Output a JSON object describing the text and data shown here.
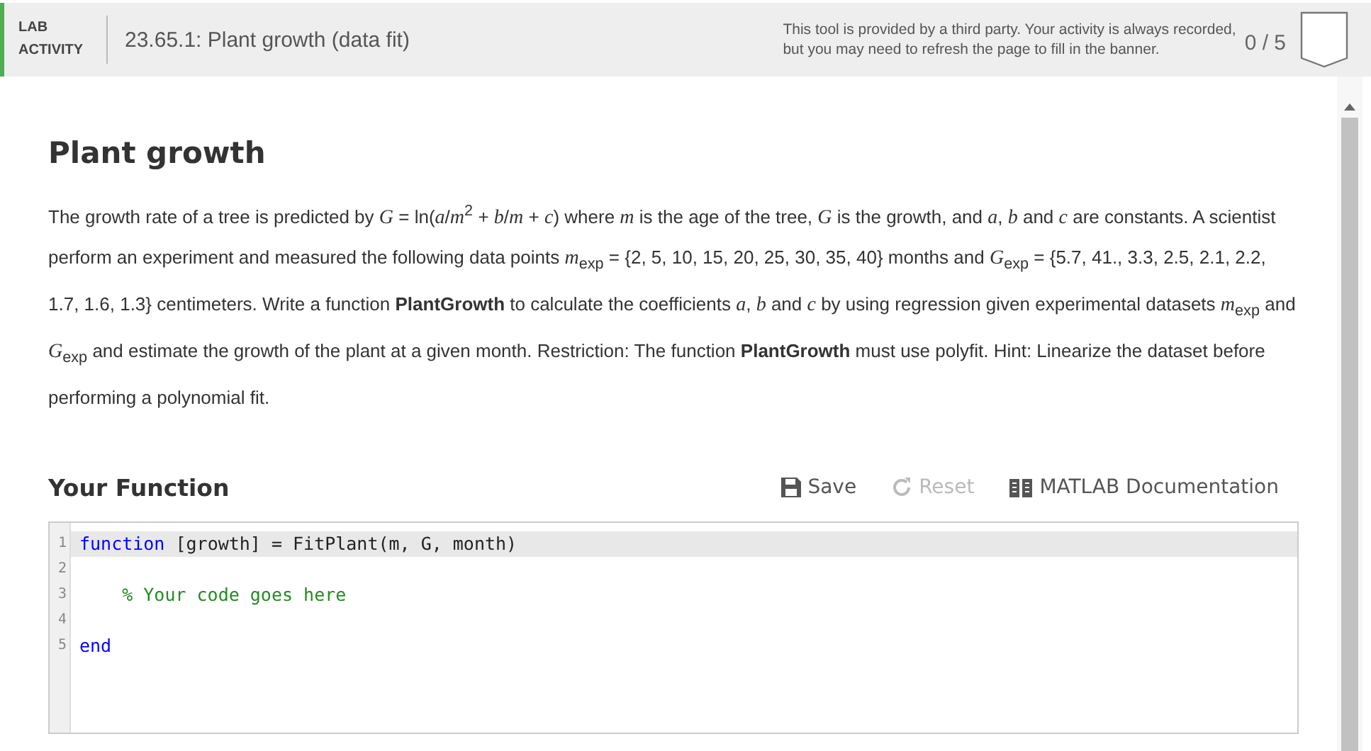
{
  "banner": {
    "label_lines": [
      "LAB",
      "ACTIVITY"
    ],
    "title": "23.65.1: Plant growth (data fit)",
    "notice_lines": [
      "This tool is provided by a third party. Your activity is always recorded,",
      "but you may need to refresh the page to fill in the banner."
    ],
    "score": "0 / 5"
  },
  "heading": "Plant growth",
  "paragraph": "The growth rate of a tree  is predicted by *G* = ln(*a*/*m*$^{2}$ + *b*/*m* + *c*) where *m* is the age of the tree, *G* is the growth, and *a*, *b* and *c* are constants.  A scientist perform an experiment and measured the following data points  *m*$_{exp}$ = {2, 5, 10, 15, 20, 25, 30, 35, 40}  months and *G*$_{exp}$ = {5.7, 41., 3.3, 2.5, 2.1, 2.2, 1.7, 1.6, 1.3} centimeters.  Write a function **PlantGrowth** to calculate the coefficients *a*, *b* and *c* by using regression given experimental datasets *m*$_{exp}$ and *G*$_{exp}$ and estimate the growth of the plant at a given month.   Restriction:  The function **PlantGrowth** must use polyfit.  Hint:  Linearize the dataset before performing a polynomial fit.",
  "function_heading": "Your Function",
  "actions": [
    {
      "label": "Save",
      "kind": "save",
      "disabled": false
    },
    {
      "label": "Reset",
      "kind": "reset",
      "disabled": true
    },
    {
      "label": "MATLAB Documentation",
      "kind": "docs",
      "disabled": false
    }
  ],
  "code_lines": [
    {
      "number": "1",
      "selected": true,
      "tokens": [
        {
          "text": "function",
          "kind": "keyword"
        },
        {
          "text": " [growth] = FitPlant(m, G, month)",
          "kind": "plain"
        }
      ]
    },
    {
      "number": "2",
      "selected": false
    },
    {
      "number": "3",
      "selected": false,
      "tokens": [
        {
          "text": "    % Your code goes here",
          "kind": "comment"
        }
      ]
    },
    {
      "number": "4",
      "selected": false
    },
    {
      "number": "5",
      "selected": false,
      "tokens": [
        {
          "text": "end",
          "kind": "keyword"
        }
      ]
    }
  ]
}
